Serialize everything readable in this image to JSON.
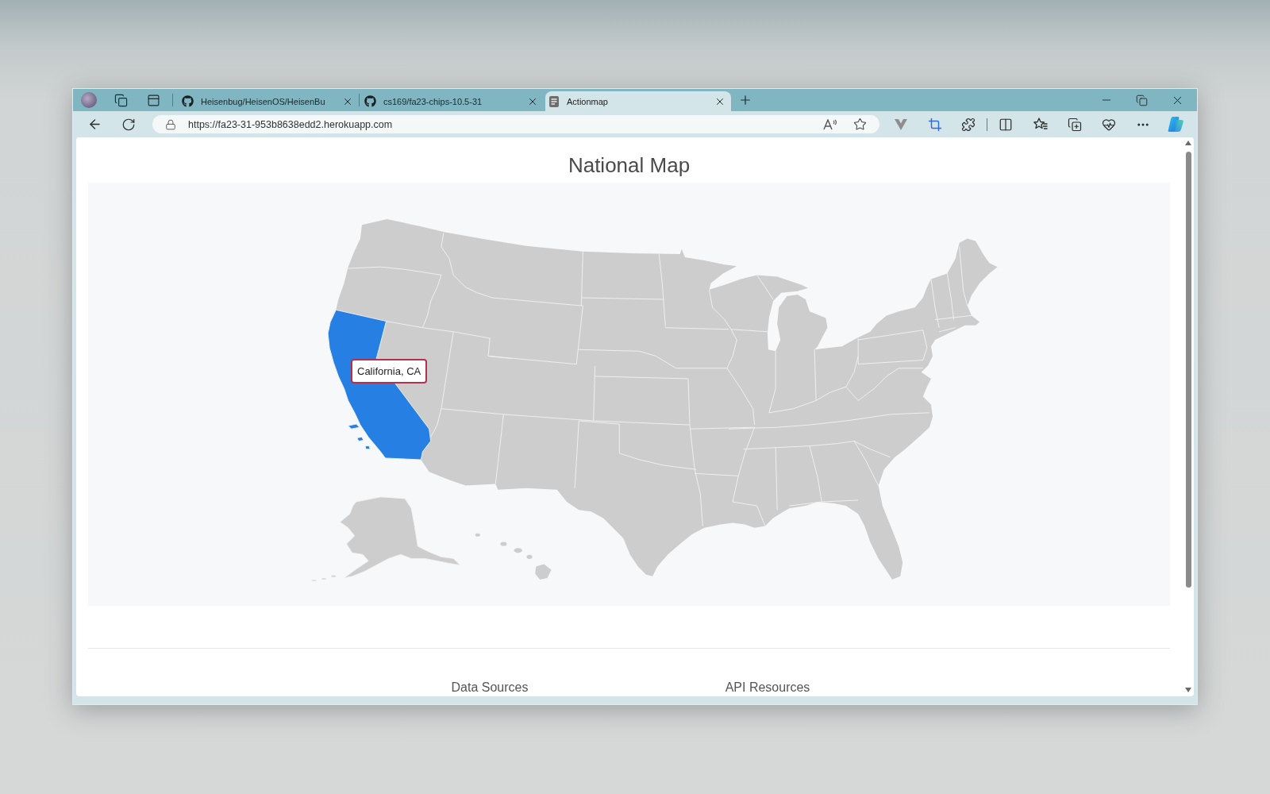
{
  "browser": {
    "tabs": [
      {
        "title": "Heisenbug/HeisenOS/HeisenBu",
        "kind": "github",
        "selected": false
      },
      {
        "title": "cs169/fa23-chips-10.5-31",
        "kind": "github",
        "selected": false
      },
      {
        "title": "Actionmap",
        "kind": "page",
        "selected": true
      }
    ],
    "address_bar": {
      "url": "https://fa23-31-953b8638edd2.herokuapp.com"
    }
  },
  "page": {
    "title": "National Map",
    "map": {
      "hovered_state": {
        "tooltip": "California, CA",
        "highlighted": true
      }
    },
    "footer_headings": [
      "Data Sources",
      "API Resources"
    ]
  }
}
